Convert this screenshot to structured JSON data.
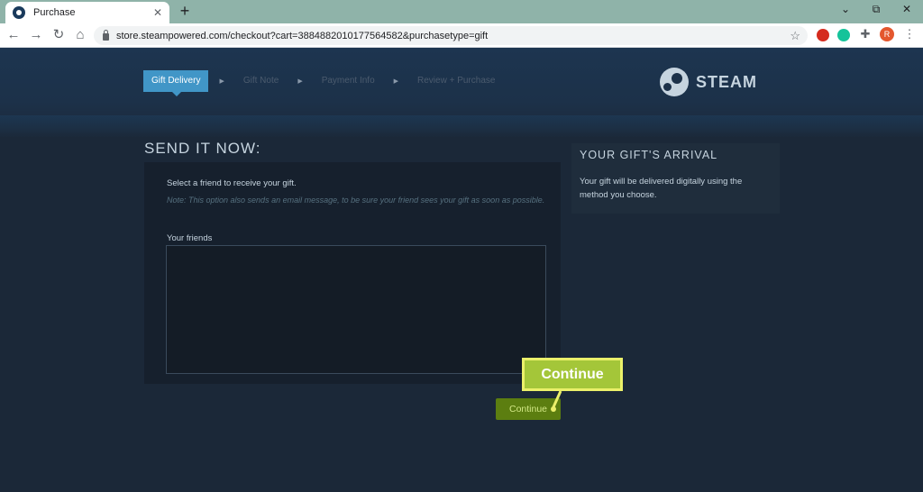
{
  "browser": {
    "tab_title": "Purchase",
    "tab_close": "✕",
    "new_tab": "+",
    "window_controls": {
      "minimize": "⌄",
      "restore": "⧉",
      "close": "✕"
    },
    "url": "store.steampowered.com/checkout?cart=3884882010177564582&purchasetype=gift",
    "nav": {
      "back": "←",
      "forward": "→",
      "reload": "↻",
      "home": "⌂"
    },
    "profile_initial": "R"
  },
  "checkout": {
    "steps": [
      {
        "label": "Gift Delivery",
        "active": true
      },
      {
        "label": "Gift Note",
        "active": false
      },
      {
        "label": "Payment Info",
        "active": false
      },
      {
        "label": "Review + Purchase",
        "active": false
      }
    ],
    "logo_text": "STEAM",
    "section_title": "SEND IT NOW:",
    "instruction": "Select a friend to receive your gift.",
    "note": "Note: This option also sends an email message, to be sure your friend sees your gift as soon as possible.",
    "friends_label": "Your friends",
    "continue_label": "Continue"
  },
  "sidebar": {
    "title": "YOUR GIFT'S ARRIVAL",
    "text": "Your gift will be delivered digitally using the method you choose."
  },
  "annotation": {
    "callout_label": "Continue"
  },
  "colors": {
    "page_bg": "#1b2838",
    "active_step": "#4196c7",
    "continue_button": "#5c7e10",
    "callout_fill": "#a4c639",
    "callout_border": "#ebf06a"
  }
}
